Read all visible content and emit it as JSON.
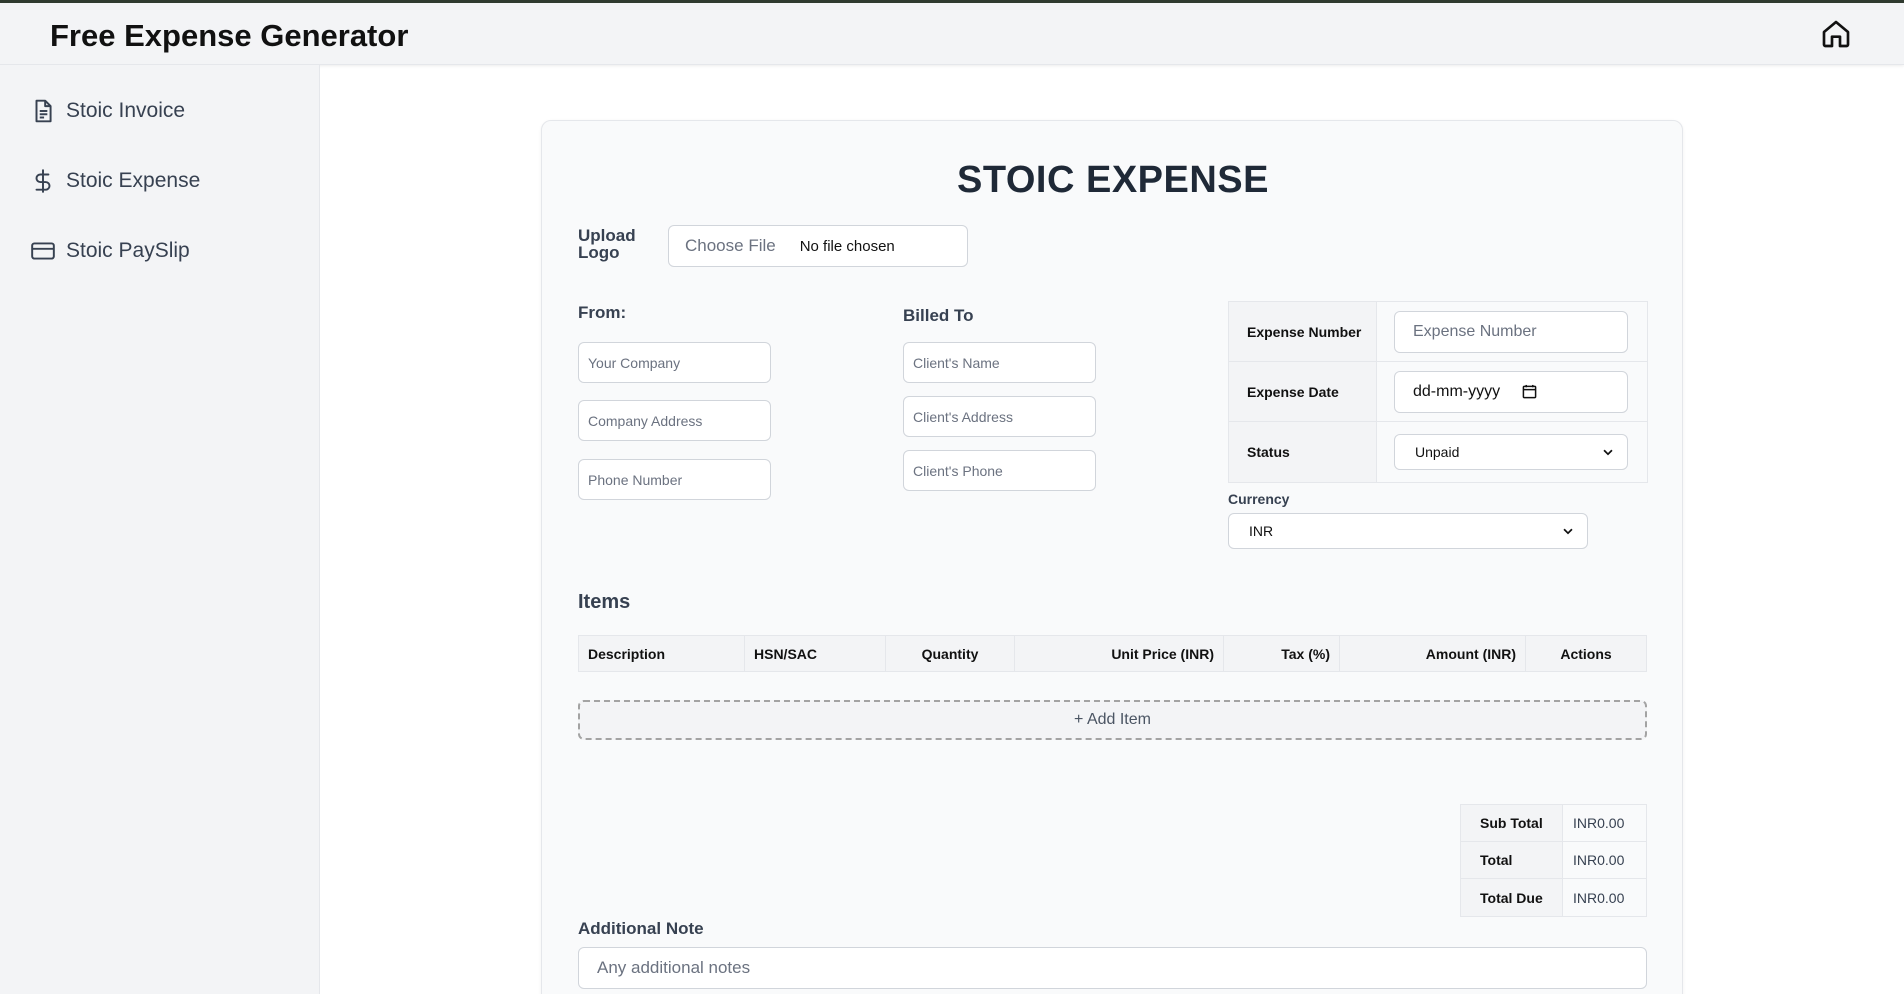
{
  "app": {
    "title": "Free Expense Generator"
  },
  "sidebar": {
    "items": [
      {
        "label": "Stoic Invoice",
        "icon": "document-icon"
      },
      {
        "label": "Stoic Expense",
        "icon": "dollar-icon"
      },
      {
        "label": "Stoic PaySlip",
        "icon": "credit-card-icon"
      }
    ]
  },
  "form": {
    "title": "STOIC EXPENSE",
    "upload": {
      "label": "Upload Logo",
      "button": "Choose File",
      "status": "No file chosen"
    },
    "from": {
      "label": "From:",
      "company_placeholder": "Your Company",
      "address_placeholder": "Company Address",
      "phone_placeholder": "Phone Number"
    },
    "billed_to": {
      "label": "Billed To",
      "name_placeholder": "Client's Name",
      "address_placeholder": "Client's Address",
      "phone_placeholder": "Client's Phone"
    },
    "meta": {
      "expense_number_label": "Expense Number",
      "expense_number_placeholder": "Expense Number",
      "expense_date_label": "Expense Date",
      "expense_date_value": "dd-mm-yyyy",
      "status_label": "Status",
      "status_value": "Unpaid"
    },
    "currency": {
      "label": "Currency",
      "value": "INR"
    },
    "items": {
      "title": "Items",
      "columns": [
        "Description",
        "HSN/SAC",
        "Quantity",
        "Unit Price (INR)",
        "Tax (%)",
        "Amount (INR)",
        "Actions"
      ],
      "add_label": "+ Add Item"
    },
    "totals": [
      {
        "label": "Sub Total",
        "value": "INR0.00"
      },
      {
        "label": "Total",
        "value": "INR0.00"
      },
      {
        "label": "Total Due",
        "value": "INR0.00"
      }
    ],
    "note": {
      "label": "Additional Note",
      "placeholder": "Any additional notes"
    }
  }
}
